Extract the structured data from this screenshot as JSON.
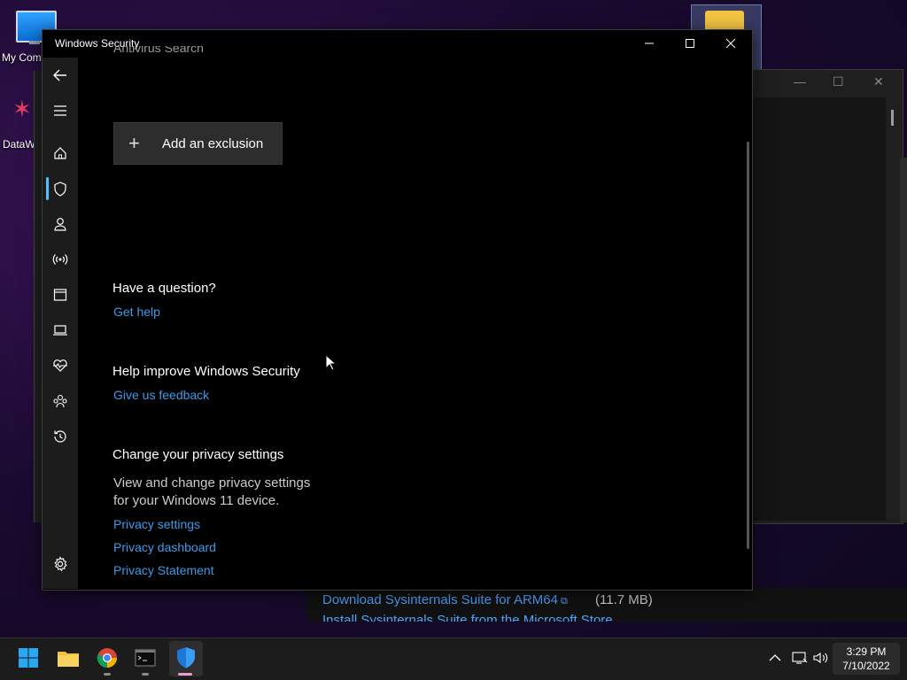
{
  "desktop": {
    "icons": [
      {
        "label": "My Com",
        "icon": "computer-icon"
      },
      {
        "label": "DataW",
        "icon": "datawarrior-icon"
      }
    ]
  },
  "background": {
    "download_link": "Download Sysinternals Suite for ARM64",
    "download_size": "(11.7 MB)",
    "install_link_partial": "Install Sysinternals Suite from the Microsoft Store"
  },
  "window": {
    "title": "Windows Security",
    "controls": {
      "minimize": "—",
      "maximize": "☐",
      "close": "✕"
    }
  },
  "sidebar": {
    "items": [
      {
        "name": "back",
        "icon": "back-arrow-icon"
      },
      {
        "name": "menu",
        "icon": "hamburger-icon"
      },
      {
        "name": "home",
        "icon": "home-icon"
      },
      {
        "name": "virus-threat-protection",
        "icon": "shield-icon",
        "selected": true
      },
      {
        "name": "account-protection",
        "icon": "person-icon"
      },
      {
        "name": "firewall-network",
        "icon": "wifi-signal-icon"
      },
      {
        "name": "app-browser-control",
        "icon": "browser-window-icon"
      },
      {
        "name": "device-security",
        "icon": "laptop-icon"
      },
      {
        "name": "device-performance-health",
        "icon": "heart-pulse-icon"
      },
      {
        "name": "family-options",
        "icon": "family-icon"
      },
      {
        "name": "protection-history",
        "icon": "history-icon"
      },
      {
        "name": "settings",
        "icon": "gear-icon"
      }
    ]
  },
  "content": {
    "clipped_heading": "Antivirus Search",
    "add_exclusion_label": "Add an exclusion",
    "question_heading": "Have a question?",
    "get_help": "Get help",
    "improve_heading": "Help improve Windows Security",
    "feedback": "Give us feedback",
    "privacy_heading": "Change your privacy settings",
    "privacy_text_line1": "View and change privacy settings",
    "privacy_text_line2": "for your Windows 11 device.",
    "privacy_settings": "Privacy settings",
    "privacy_dashboard": "Privacy dashboard",
    "privacy_statement": "Privacy Statement"
  },
  "taskbar": {
    "apps": [
      {
        "name": "start",
        "icon": "windows-logo-icon"
      },
      {
        "name": "file-explorer",
        "icon": "folder-icon"
      },
      {
        "name": "chrome",
        "icon": "chrome-icon"
      },
      {
        "name": "terminal",
        "icon": "terminal-icon"
      },
      {
        "name": "windows-security",
        "icon": "shield-icon",
        "active": true
      }
    ],
    "tray": {
      "chevron": "^",
      "time": "3:29 PM",
      "date": "7/10/2022"
    }
  },
  "colors": {
    "accent": "#4cc2ff",
    "link": "#3d9ae8",
    "window_bg": "#000000",
    "sidebar_bg": "#1c1c1c"
  }
}
